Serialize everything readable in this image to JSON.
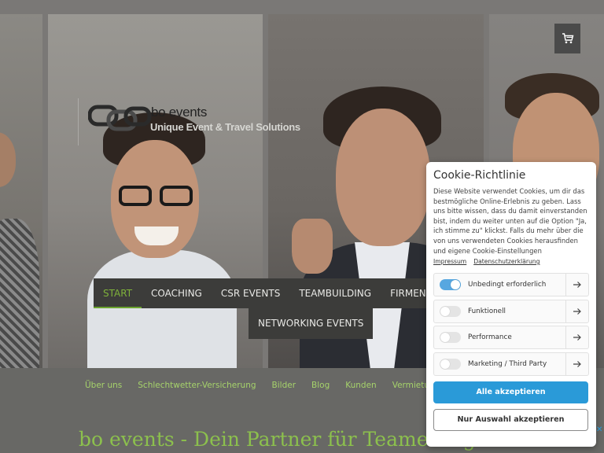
{
  "header": {
    "logo_title": "bo events",
    "logo_subtitle": "Unique Event & Travel Solutions",
    "cart_icon": "cart-icon"
  },
  "main_nav": {
    "items": [
      {
        "label": "START",
        "active": true
      },
      {
        "label": "COACHING",
        "active": false
      },
      {
        "label": "CSR EVENTS",
        "active": false
      },
      {
        "label": "TEAMBUILDING",
        "active": false
      },
      {
        "label": "FIRMENFEIER",
        "active": false
      }
    ],
    "row2": [
      {
        "label": "NETWORKING EVENTS",
        "active": false
      }
    ],
    "accent_color": "#7fb23a"
  },
  "sub_nav": {
    "items": [
      "Über uns",
      "Schlechtwetter-Versicherung",
      "Bilder",
      "Blog",
      "Kunden",
      "Vermietung"
    ]
  },
  "headline": "bo events - Dein Partner für Teamerfolg",
  "cookie_modal": {
    "title": "Cookie-Richtlinie",
    "text": "Diese Website verwendet Cookies, um dir das bestmögliche Online-Erlebnis zu geben. Lass uns bitte wissen, dass du damit einverstanden bist, indem du weiter unten auf die Option \"Ja, ich stimme zu\" klickst. Falls du mehr über die von uns verwendeten Cookies herausfinden und eigene Cookie-Einstellungen",
    "links": [
      "Impressum",
      "Datenschutzerklärung"
    ],
    "toggles": [
      {
        "label": "Unbedingt erforderlich",
        "on": true
      },
      {
        "label": "Funktionell",
        "on": false
      },
      {
        "label": "Performance",
        "on": false
      },
      {
        "label": "Marketing / Third Party",
        "on": false
      }
    ],
    "accept_all": "Alle akzeptieren",
    "accept_selection": "Nur Auswahl akzeptieren",
    "primary_color": "#2a9ad8",
    "toggle_on_color": "#57a7e0"
  }
}
